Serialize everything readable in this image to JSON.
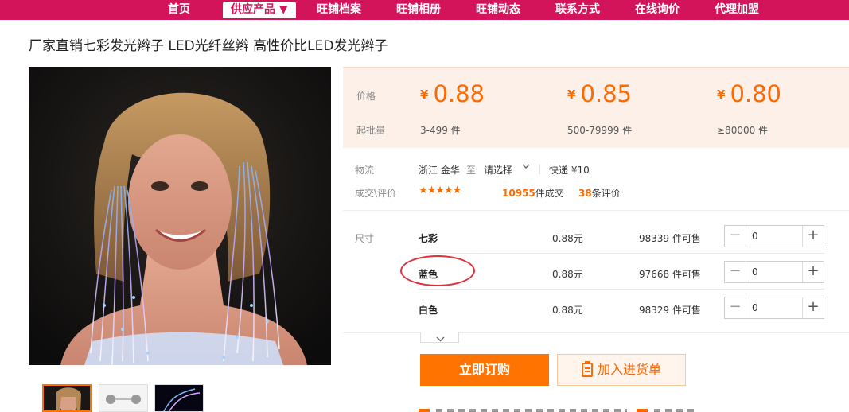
{
  "nav": {
    "items": [
      {
        "label": "首页"
      },
      {
        "label": "供应产品 ▼"
      },
      {
        "label": "旺铺档案"
      },
      {
        "label": "旺铺相册"
      },
      {
        "label": "旺铺动态"
      },
      {
        "label": "联系方式"
      },
      {
        "label": "在线询价"
      },
      {
        "label": "代理加盟"
      }
    ],
    "active_index": 1,
    "bg_color": "#d3145a"
  },
  "product": {
    "title": "厂家直销七彩发光辫子 LED光纤丝辫 高性价比LED发光辫子"
  },
  "pricing": {
    "price_label": "价格",
    "min_qty_label": "起批量",
    "currency": "¥",
    "tiers": [
      {
        "price": "0.88",
        "range": "3-499 件"
      },
      {
        "price": "0.85",
        "range": "500-79999 件"
      },
      {
        "price": "0.80",
        "range": "≥80000 件"
      }
    ]
  },
  "logistics": {
    "label": "物流",
    "origin": "浙江 金华",
    "to": "至",
    "destination": "请选择",
    "shipping": "快递 ¥10"
  },
  "reviews": {
    "label": "成交\\评价",
    "rating": 4.5,
    "stars_text": "★★★★★",
    "deals_count": "10955",
    "deals_suffix": "件成交",
    "review_count": "38",
    "review_suffix": "条评价"
  },
  "sku": {
    "label": "尺寸",
    "items": [
      {
        "name": "七彩",
        "price": "0.88元",
        "stock": "98339 件可售",
        "qty": "0"
      },
      {
        "name": "蓝色",
        "price": "0.88元",
        "stock": "97668 件可售",
        "qty": "0"
      },
      {
        "name": "白色",
        "price": "0.88元",
        "stock": "98329 件可售",
        "qty": "0"
      }
    ],
    "highlighted": "蓝色"
  },
  "actions": {
    "order_label": "立即订购",
    "cart_label": "加入进货单"
  },
  "colors": {
    "accent": "#ff6a00",
    "order_button": "#ff7300",
    "annotation": "#e0303a"
  }
}
